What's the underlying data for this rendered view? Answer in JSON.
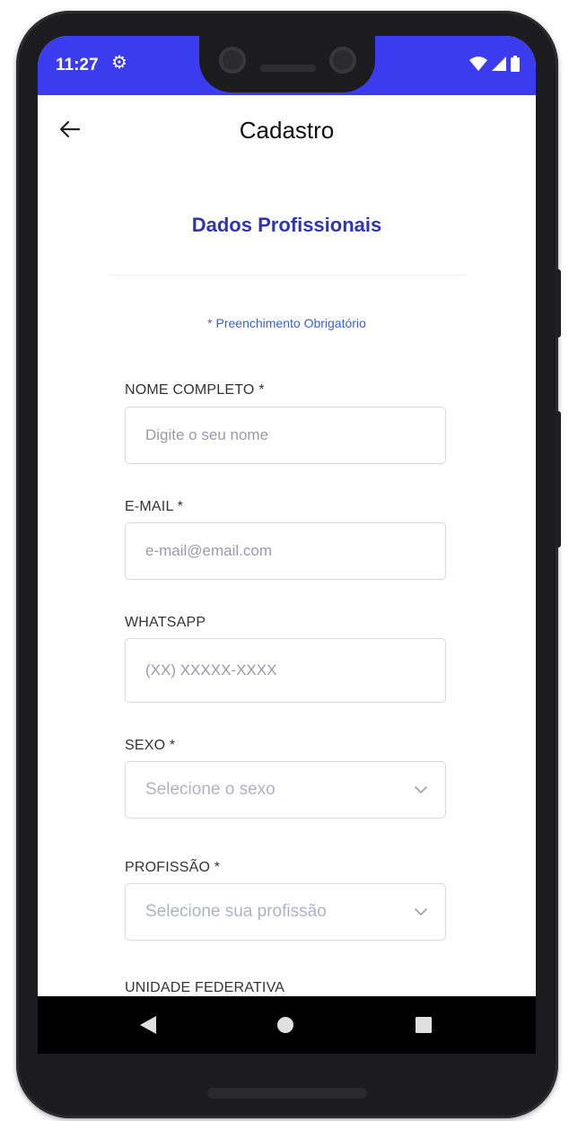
{
  "status_bar": {
    "time": "11:27",
    "settings_icon": "gear-icon",
    "wifi_icon": "wifi-icon",
    "signal_icon": "signal-icon",
    "battery_icon": "battery-icon",
    "background": "#3b3bf0"
  },
  "header": {
    "back_icon": "arrow-left-icon",
    "title": "Cadastro"
  },
  "form": {
    "section_title": "Dados Profissionais",
    "required_note": "* Preenchimento Obrigatório",
    "accent_color": "#2d35b4",
    "fields": {
      "name": {
        "label": "NOME COMPLETO *",
        "placeholder": "Digite o seu nome"
      },
      "email": {
        "label": "E-MAIL *",
        "placeholder": "e-mail@email.com"
      },
      "whatsapp": {
        "label": "WHATSAPP",
        "placeholder": "(XX) XXXXX-XXXX"
      },
      "sex": {
        "label": "SEXO *",
        "selected": "Selecione o sexo"
      },
      "profession": {
        "label": "PROFISSÃO *",
        "selected": "Selecione sua profissão"
      },
      "state": {
        "label": "UNIDADE FEDERATIVA"
      }
    }
  },
  "nav": {
    "back_icon": "triangle-back-icon",
    "home_icon": "circle-home-icon",
    "recent_icon": "square-recents-icon"
  }
}
